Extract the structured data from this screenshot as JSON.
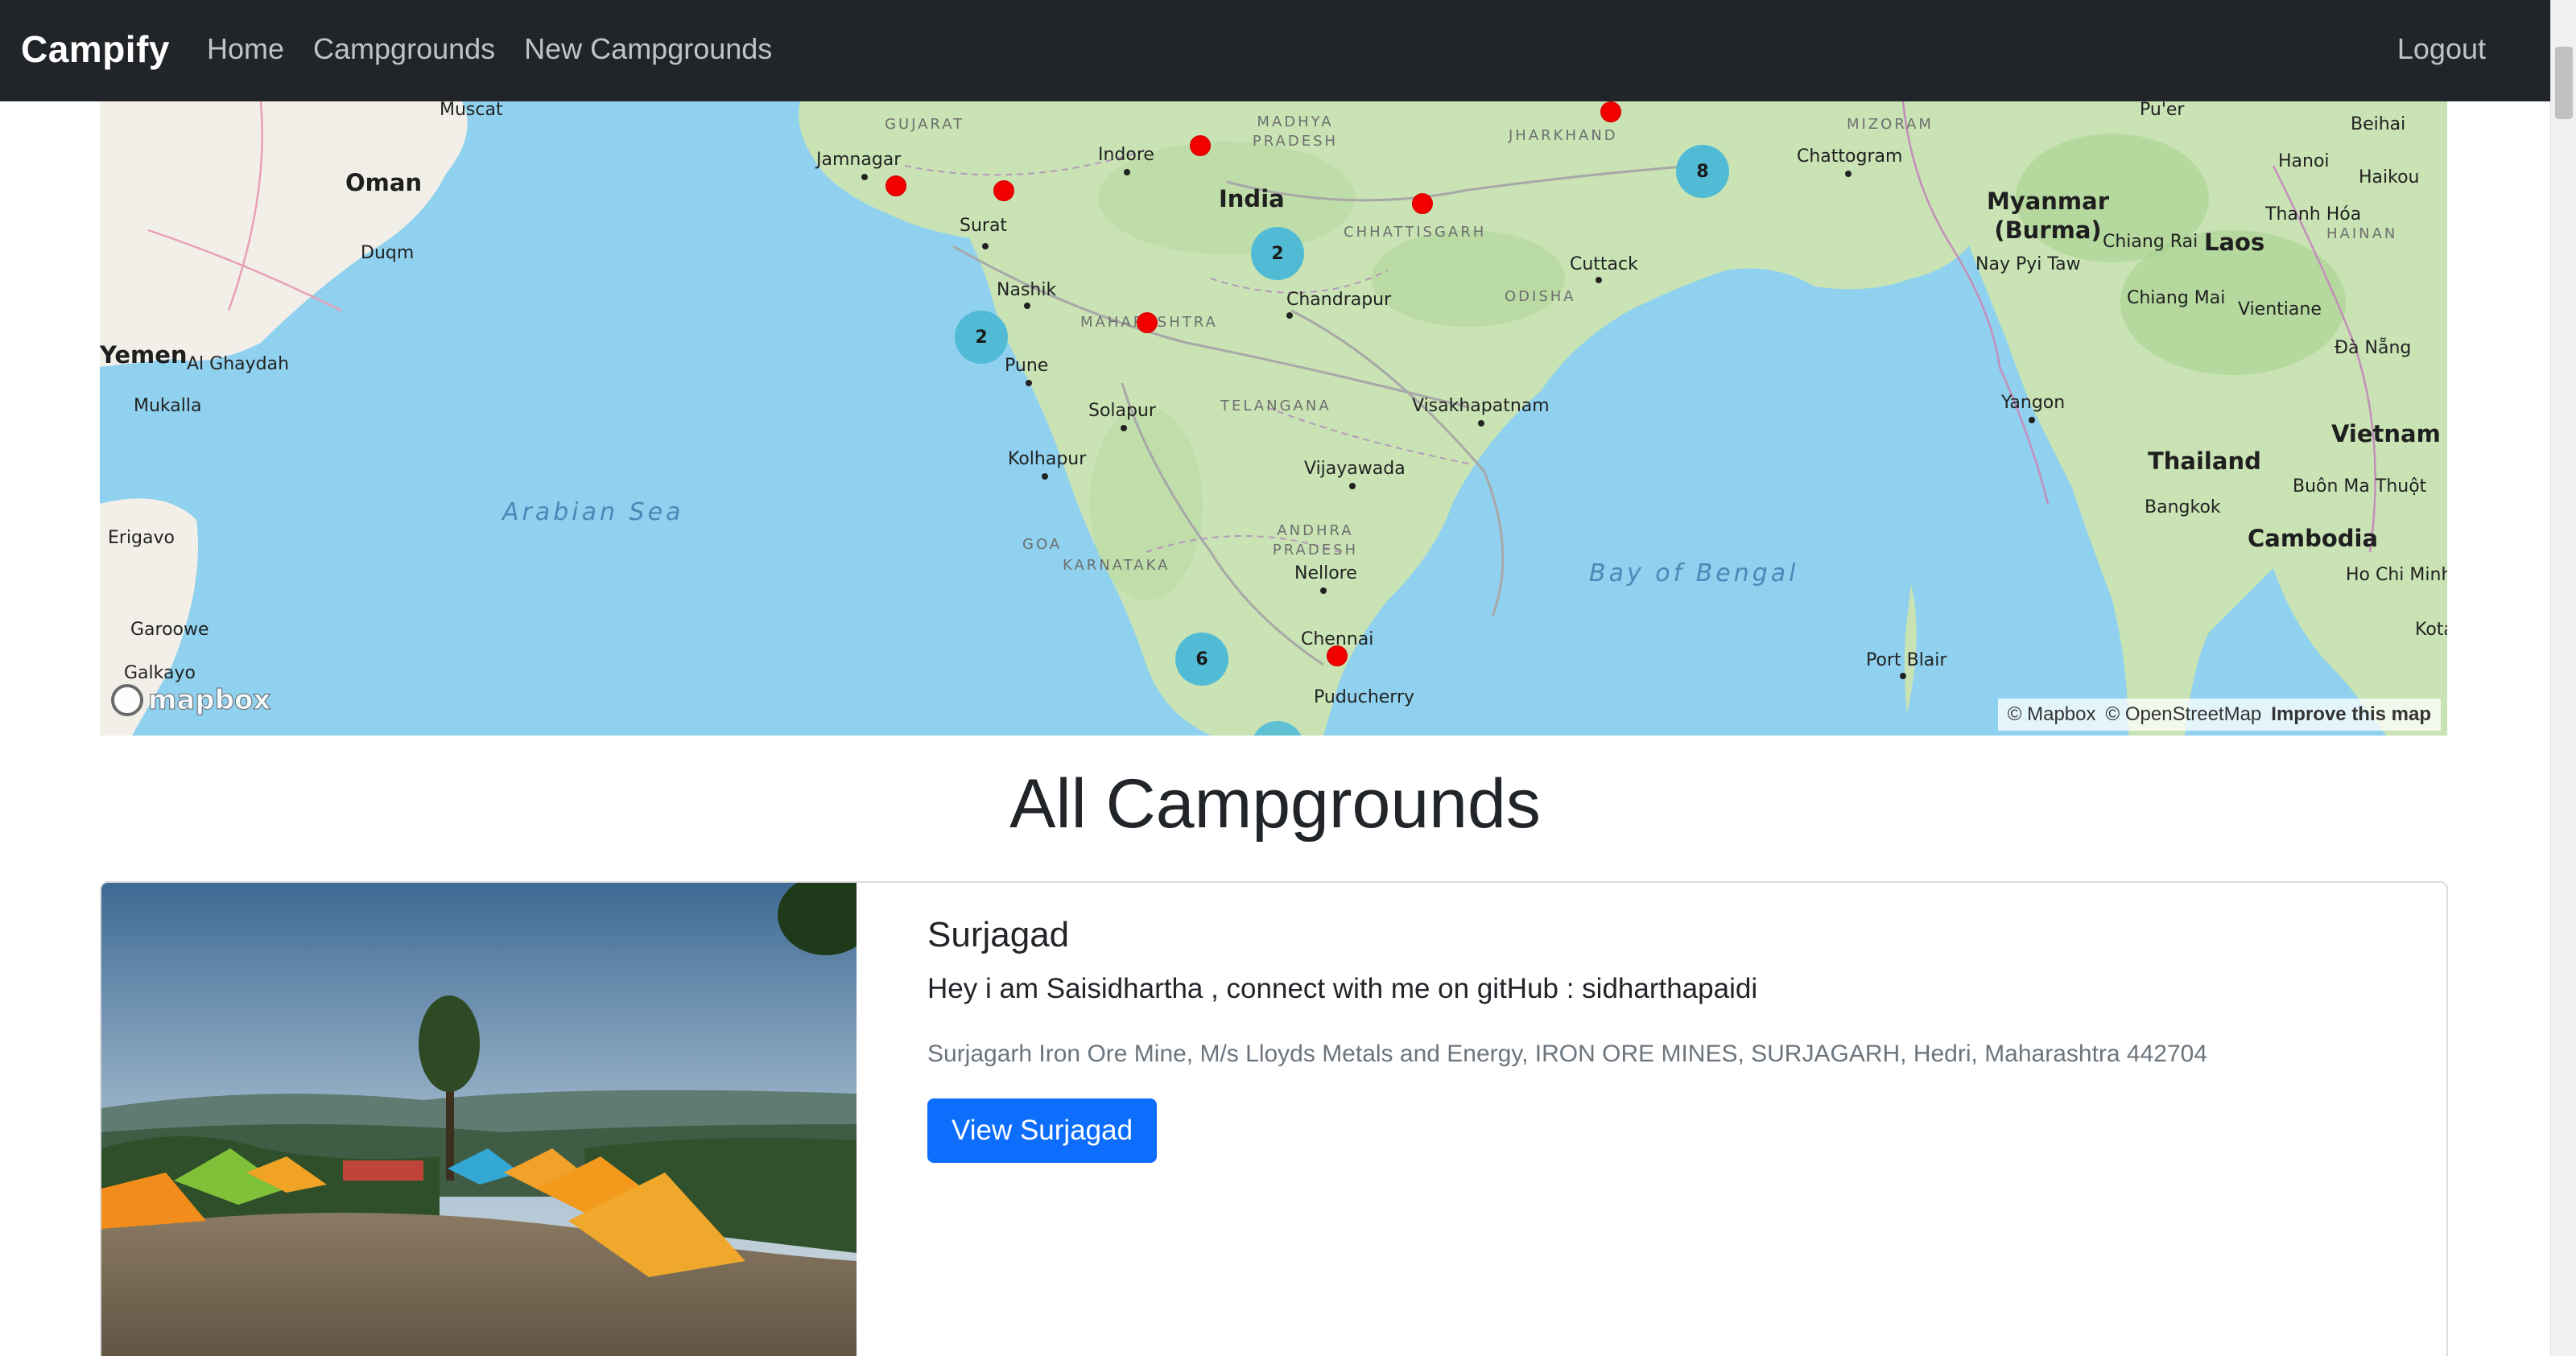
{
  "navbar": {
    "brand": "Campify",
    "links": [
      "Home",
      "Campgrounds",
      "New Campgrounds"
    ],
    "logout": "Logout"
  },
  "map": {
    "countries": [
      "Oman",
      "India",
      "Yemen",
      "Myanmar (Burma)",
      "Laos",
      "Thailand",
      "Vietnam",
      "Cambodia"
    ],
    "seas": [
      "Arabian Sea",
      "Bay of Bengal"
    ],
    "states": [
      "GUJARAT",
      "MADHYA PRADESH",
      "JHARKHAND",
      "CHHATTISGARH",
      "ODISHA",
      "MAHARASHTRA",
      "TELANGANA",
      "ANDHRA PRADESH",
      "KARNATAKA",
      "MIZORAM",
      "HAINAN",
      "GOA"
    ],
    "cities": [
      "Muscat",
      "Jamnagar",
      "Indore",
      "Surat",
      "Nashik",
      "Pune",
      "Solapur",
      "Kolhapur",
      "Chandrapur",
      "Cuttack",
      "Visakhapatnam",
      "Vijayawada",
      "Nellore",
      "Chennai",
      "Puducherry",
      "Chattogram",
      "Hanoi",
      "Haikou",
      "Beihai",
      "Thanh Hóa",
      "Chiang Rai",
      "Chiang Mai",
      "Vientiane",
      "Nay Pyi Taw",
      "Yangon",
      "Bangkok",
      "Đà Nẵng",
      "Buôn Ma Thuột",
      "Ho Chi Minh",
      "Port Blair",
      "Duqm",
      "Al Ghaydah",
      "Mukalla",
      "Erigavo",
      "Garoowe",
      "Galkayo",
      "Pu'er",
      "Kota"
    ],
    "clusters": [
      "8",
      "2",
      "2",
      "6"
    ],
    "logo": "mapbox",
    "attribution": {
      "mapbox": "© Mapbox",
      "osm": "© OpenStreetMap",
      "improve": "Improve this map"
    }
  },
  "page": {
    "title": "All Campgrounds"
  },
  "campgrounds": [
    {
      "title": "Surjagad",
      "description": "Hey i am Saisidhartha , connect with me on gitHub : sidharthapaidi",
      "location": "Surjagarh Iron Ore Mine, M/s Lloyds Metals and Energy, IRON ORE MINES, SURJAGARH, Hedri, Maharashtra 442704",
      "button": "View Surjagad"
    }
  ],
  "colors": {
    "navbar": "#212529",
    "primary": "#0d6efd",
    "marker": "#f20000",
    "cluster": "#51bbd6",
    "ocean": "#8fd1ee",
    "land": "#c9e3b4"
  }
}
